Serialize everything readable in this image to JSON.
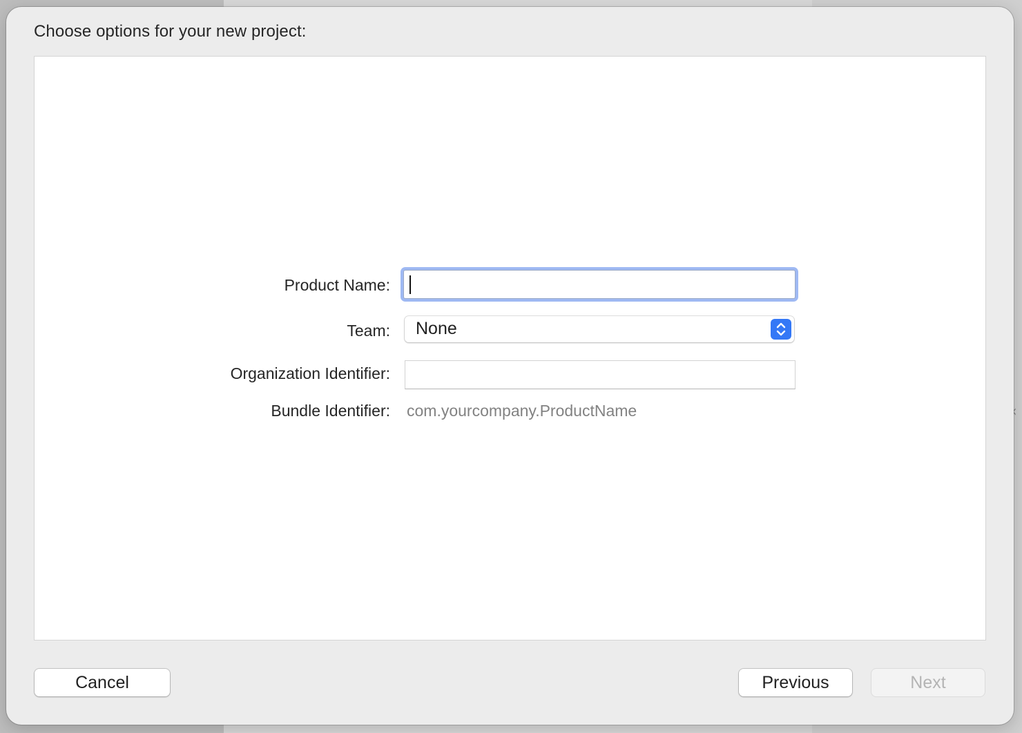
{
  "dialog": {
    "title": "Choose options for your new project:"
  },
  "form": {
    "product_name": {
      "label": "Product Name:",
      "value": ""
    },
    "team": {
      "label": "Team:",
      "selected": "None"
    },
    "organization_identifier": {
      "label": "Organization Identifier:",
      "value": ""
    },
    "bundle_identifier": {
      "label": "Bundle Identifier:",
      "value": "com.yourcompany.ProductName"
    }
  },
  "buttons": {
    "cancel": "Cancel",
    "previous": "Previous",
    "next": "Next"
  },
  "colors": {
    "accent": "#3478f6",
    "focus_ring": "#9fb9f3",
    "disabled_text": "#b4b4b4"
  },
  "icons": {
    "team_popup": "up-down-chevron-icon"
  }
}
